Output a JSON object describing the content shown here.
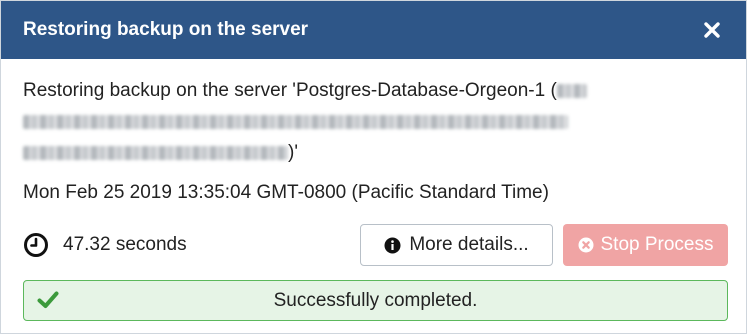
{
  "dialog": {
    "title": "Restoring backup on the server",
    "message_prefix": "Restoring backup on the server 'Postgres-Database-Orgeon-1 (",
    "message_suffix": ")'",
    "timestamp": "Mon Feb 25 2019 13:35:04 GMT-0800 (Pacific Standard Time)",
    "elapsed": "47.32 seconds",
    "more_details_label": "More details...",
    "stop_process_label": "Stop Process",
    "status_message": "Successfully completed."
  },
  "icons": {
    "close": "close-icon",
    "clock": "clock-icon",
    "info": "info-circle-icon",
    "stop": "times-circle-icon",
    "check": "check-icon"
  },
  "colors": {
    "header_bg": "#2e5688",
    "stop_button_bg": "#f0a4a4",
    "success_bg": "#e6f4e6",
    "success_border": "#5cb85c",
    "check_color": "#3c9a3c"
  }
}
